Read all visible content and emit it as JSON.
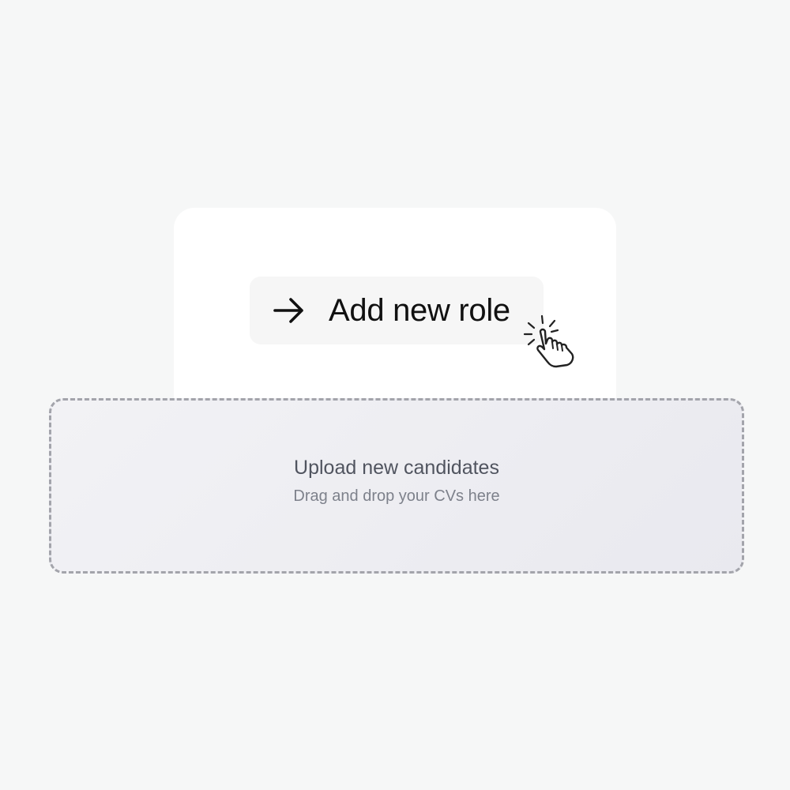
{
  "add_role": {
    "label": "Add new role",
    "icon": "arrow-right-icon"
  },
  "cursor": {
    "icon": "hand-pointer-click-icon"
  },
  "upload": {
    "title": "Upload new candidates",
    "subtitle": "Drag and drop your CVs here"
  },
  "colors": {
    "background": "#f6f7f7",
    "card": "#ffffff",
    "button": "#f6f6f6",
    "dropzone_border": "#a3a4ab",
    "dropzone_fill": "#eeeef2",
    "title_text": "#50545f",
    "subtitle_text": "#7d818b"
  }
}
